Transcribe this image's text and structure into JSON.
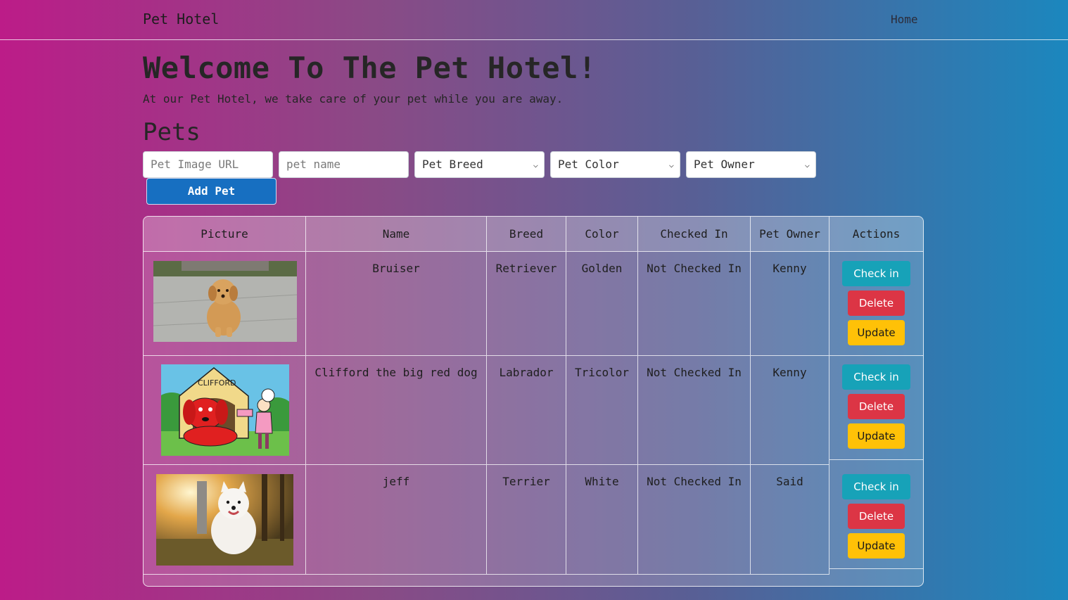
{
  "navbar": {
    "brand": "Pet Hotel",
    "home": "Home"
  },
  "hero": {
    "title": "Welcome To The Pet Hotel!",
    "subtitle": "At our Pet Hotel, we take care of your pet while you are away."
  },
  "section": {
    "title": "Pets"
  },
  "form": {
    "image_url_placeholder": "Pet Image URL",
    "name_placeholder": "pet name",
    "breed_select": "Pet Breed",
    "color_select": "Pet Color",
    "owner_select": "Pet Owner",
    "add_button": "Add Pet"
  },
  "table": {
    "headers": [
      "Picture",
      "Name",
      "Breed",
      "Color",
      "Checked In",
      "Pet Owner",
      "Actions"
    ],
    "rows": [
      {
        "name": "Bruiser",
        "breed": "Retriever",
        "color": "Golden",
        "checked_in": "Not Checked In",
        "owner": "Kenny",
        "picture": "golden-retriever-puppy"
      },
      {
        "name": "Clifford the big red dog",
        "breed": "Labrador",
        "color": "Tricolor",
        "checked_in": "Not Checked In",
        "owner": "Kenny",
        "picture": "clifford-cartoon"
      },
      {
        "name": "jeff",
        "breed": "Terrier",
        "color": "White",
        "checked_in": "Not Checked In",
        "owner": "Said",
        "picture": "white-samoyed"
      }
    ],
    "actions": {
      "check_in": "Check in",
      "delete": "Delete",
      "update": "Update"
    }
  },
  "colors": {
    "add_button": "#176fc1",
    "check_in": "#17a2b8",
    "delete": "#dc3545",
    "update": "#ffc107",
    "gradient_left": "#bc1c88",
    "gradient_right": "#1b87be"
  }
}
